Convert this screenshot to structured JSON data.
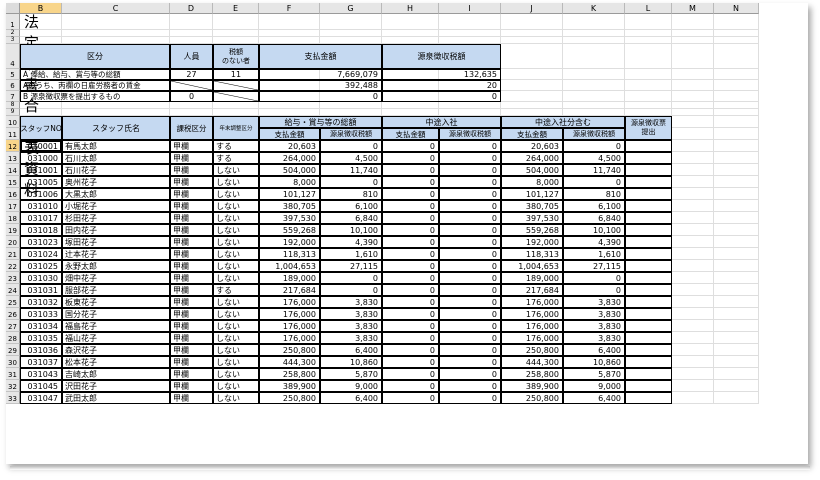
{
  "columns": [
    "B",
    "C",
    "D",
    "E",
    "F",
    "G",
    "H",
    "I",
    "J",
    "K",
    "L",
    "M",
    "N"
  ],
  "selected_column": "B",
  "selected_row": "12",
  "row_numbers": [
    "1",
    "2",
    "3",
    "4",
    "5",
    "6",
    "7",
    "8",
    "9",
    "10",
    "11",
    "12",
    "13",
    "14",
    "15",
    "16",
    "17",
    "18",
    "19",
    "20",
    "21",
    "22",
    "23",
    "24",
    "25",
    "26",
    "27",
    "28",
    "29",
    "30",
    "31",
    "32",
    "33"
  ],
  "title": "法定調書合計表資料",
  "summary": {
    "headers": {
      "kubun": "区分",
      "ninzu": "人員",
      "zeigaku_nashi": "税額\nのない者",
      "shiharai": "支払金額",
      "gensen": "源泉徴収税額"
    },
    "rows": [
      {
        "label": "A 俸給、給与、賞与等の総額",
        "ninzu": "27",
        "zeigaku_nashi": "11",
        "shiharai": "7,669,079",
        "gensen": "132,635"
      },
      {
        "label": "Aのうち、丙欄の日雇労務者の賃金",
        "ninzu": "",
        "zeigaku_nashi": "",
        "shiharai": "392,488",
        "gensen": "20"
      },
      {
        "label": "B 源泉徴収票を提出するもの",
        "ninzu": "0",
        "zeigaku_nashi": "",
        "shiharai": "0",
        "gensen": "0"
      }
    ]
  },
  "detail": {
    "headers": {
      "staff_no": "スタッフNO",
      "staff_name": "スタッフ氏名",
      "kazei": "課税区分",
      "nenmatsu": "年末調整区分",
      "group1": "給与・賞与等の総額",
      "group2": "中途入社",
      "group3": "中途入社分含む",
      "teishutsu": "源泉徴収票\n提出",
      "shiharai": "支払金額",
      "gensen": "源泉徴収税額"
    },
    "rows": [
      [
        "030001",
        "有馬太郎",
        "甲欄",
        "する",
        "20,603",
        "0",
        "0",
        "0",
        "20,603",
        "0"
      ],
      [
        "031000",
        "石川太郎",
        "甲欄",
        "する",
        "264,000",
        "4,500",
        "0",
        "0",
        "264,000",
        "4,500"
      ],
      [
        "031001",
        "石川花子",
        "甲欄",
        "しない",
        "504,000",
        "11,740",
        "0",
        "0",
        "504,000",
        "11,740"
      ],
      [
        "031005",
        "奥州花子",
        "甲欄",
        "しない",
        "8,000",
        "0",
        "0",
        "0",
        "8,000",
        "0"
      ],
      [
        "031006",
        "大黒太郎",
        "甲欄",
        "しない",
        "101,127",
        "810",
        "0",
        "0",
        "101,127",
        "810"
      ],
      [
        "031010",
        "小堀花子",
        "甲欄",
        "しない",
        "380,705",
        "6,100",
        "0",
        "0",
        "380,705",
        "6,100"
      ],
      [
        "031017",
        "杉田花子",
        "甲欄",
        "しない",
        "397,530",
        "6,840",
        "0",
        "0",
        "397,530",
        "6,840"
      ],
      [
        "031018",
        "田内花子",
        "甲欄",
        "しない",
        "559,268",
        "10,100",
        "0",
        "0",
        "559,268",
        "10,100"
      ],
      [
        "031023",
        "塚田花子",
        "甲欄",
        "しない",
        "192,000",
        "4,390",
        "0",
        "0",
        "192,000",
        "4,390"
      ],
      [
        "031024",
        "辻本花子",
        "甲欄",
        "しない",
        "118,313",
        "1,610",
        "0",
        "0",
        "118,313",
        "1,610"
      ],
      [
        "031025",
        "永野太郎",
        "甲欄",
        "しない",
        "1,004,653",
        "27,115",
        "0",
        "0",
        "1,004,653",
        "27,115"
      ],
      [
        "031030",
        "畑中花子",
        "甲欄",
        "しない",
        "189,000",
        "0",
        "0",
        "0",
        "189,000",
        "0"
      ],
      [
        "031031",
        "服部花子",
        "甲欄",
        "する",
        "217,684",
        "0",
        "0",
        "0",
        "217,684",
        "0"
      ],
      [
        "031032",
        "板東花子",
        "甲欄",
        "しない",
        "176,000",
        "3,830",
        "0",
        "0",
        "176,000",
        "3,830"
      ],
      [
        "031033",
        "国分花子",
        "甲欄",
        "しない",
        "176,000",
        "3,830",
        "0",
        "0",
        "176,000",
        "3,830"
      ],
      [
        "031034",
        "福島花子",
        "甲欄",
        "しない",
        "176,000",
        "3,830",
        "0",
        "0",
        "176,000",
        "3,830"
      ],
      [
        "031035",
        "福山花子",
        "甲欄",
        "しない",
        "176,000",
        "3,830",
        "0",
        "0",
        "176,000",
        "3,830"
      ],
      [
        "031036",
        "森沢花子",
        "甲欄",
        "しない",
        "250,800",
        "6,400",
        "0",
        "0",
        "250,800",
        "6,400"
      ],
      [
        "031037",
        "松本花子",
        "甲欄",
        "しない",
        "444,300",
        "10,860",
        "0",
        "0",
        "444,300",
        "10,860"
      ],
      [
        "031043",
        "吉崎太郎",
        "甲欄",
        "しない",
        "258,800",
        "5,870",
        "0",
        "0",
        "258,800",
        "5,870"
      ],
      [
        "031045",
        "沢田花子",
        "甲欄",
        "しない",
        "389,900",
        "9,000",
        "0",
        "0",
        "389,900",
        "9,000"
      ],
      [
        "031047",
        "武田太郎",
        "甲欄",
        "しない",
        "250,800",
        "6,400",
        "0",
        "0",
        "250,800",
        "6,400"
      ]
    ]
  }
}
